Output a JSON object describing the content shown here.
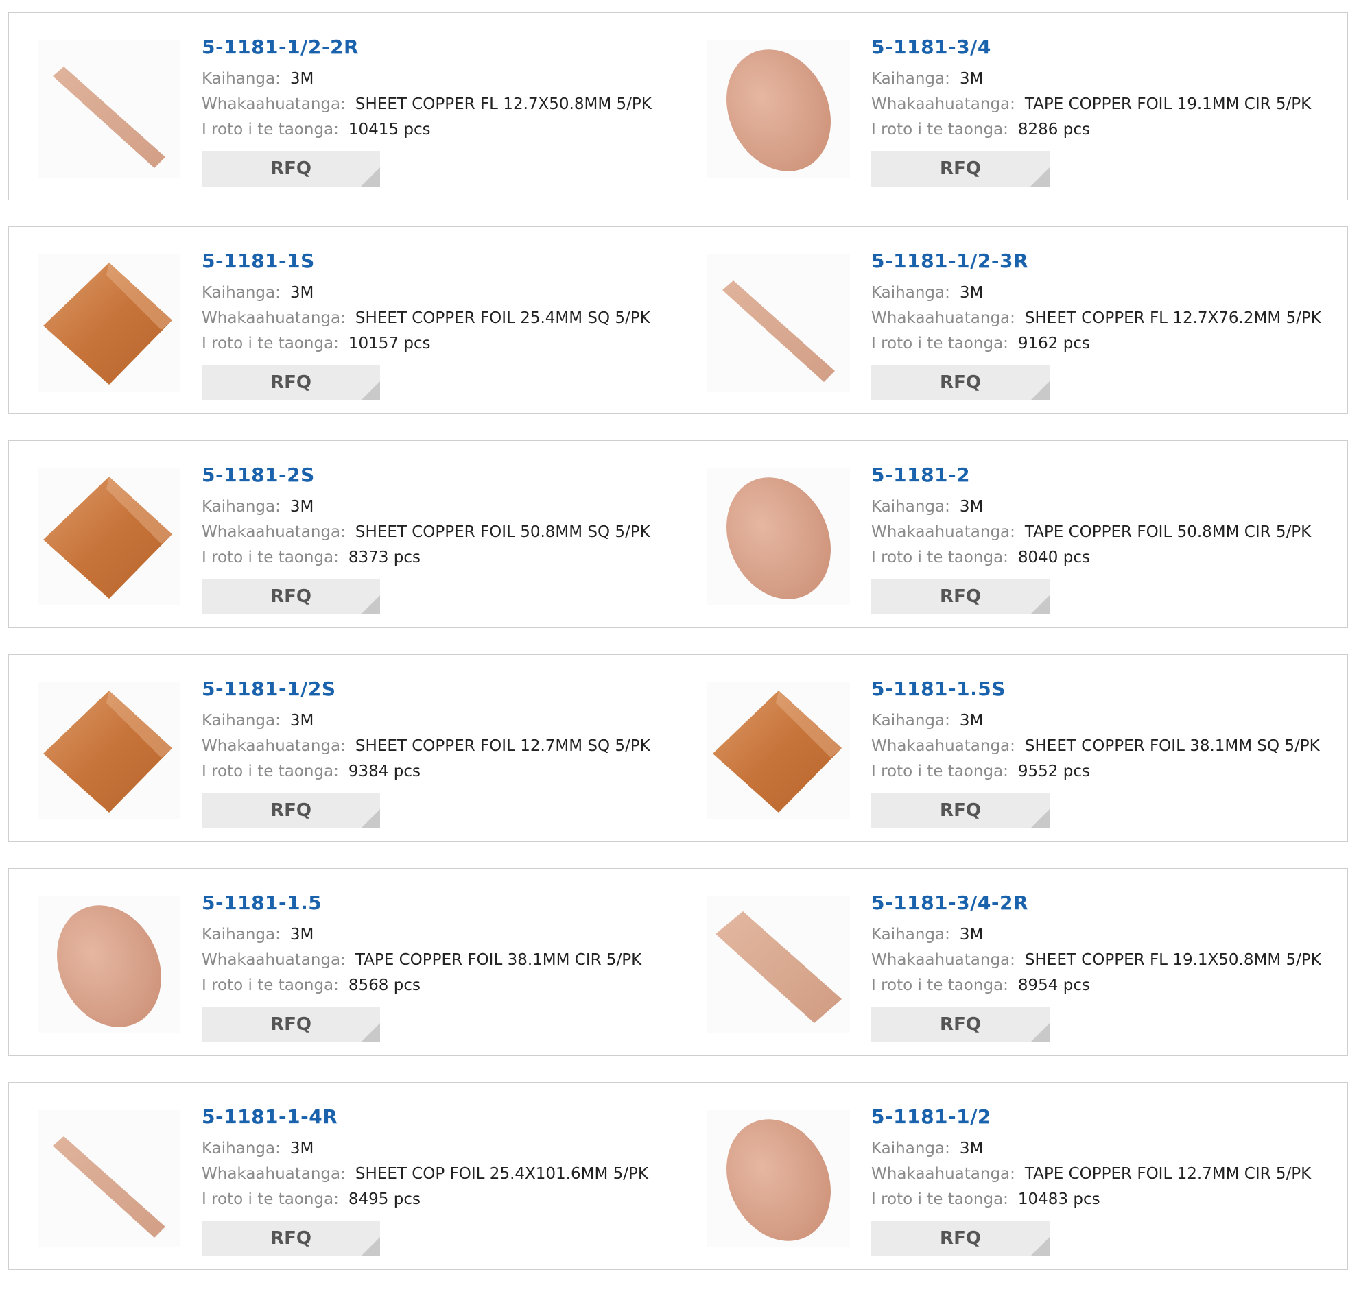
{
  "labels": {
    "manufacturer": "Kaihanga:",
    "description": "Whakaahuatanga:",
    "stock": "I roto i te taonga:",
    "rfq": "RFQ"
  },
  "colors": {
    "part_number": "#1a62ac",
    "copper_sheet": "#c9773e",
    "copper_tape": "#d9a08a"
  },
  "products": [
    {
      "part": "5-1181-1/2-2R",
      "manufacturer": "3M",
      "description": "SHEET COPPER FL 12.7X50.8MM 5/PK",
      "stock": "10415 pcs",
      "image": "strip-icon"
    },
    {
      "part": "5-1181-3/4",
      "manufacturer": "3M",
      "description": "TAPE COPPER FOIL 19.1MM CIR 5/PK",
      "stock": "8286 pcs",
      "image": "disc-icon"
    },
    {
      "part": "5-1181-1S",
      "manufacturer": "3M",
      "description": "SHEET COPPER FOIL 25.4MM SQ 5/PK",
      "stock": "10157 pcs",
      "image": "square-sheet-icon"
    },
    {
      "part": "5-1181-1/2-3R",
      "manufacturer": "3M",
      "description": "SHEET COPPER FL 12.7X76.2MM 5/PK",
      "stock": "9162 pcs",
      "image": "strip-icon"
    },
    {
      "part": "5-1181-2S",
      "manufacturer": "3M",
      "description": "SHEET COPPER FOIL 50.8MM SQ 5/PK",
      "stock": "8373 pcs",
      "image": "square-sheet-icon"
    },
    {
      "part": "5-1181-2",
      "manufacturer": "3M",
      "description": "TAPE COPPER FOIL 50.8MM CIR 5/PK",
      "stock": "8040 pcs",
      "image": "disc-icon"
    },
    {
      "part": "5-1181-1/2S",
      "manufacturer": "3M",
      "description": "SHEET COPPER FOIL 12.7MM SQ 5/PK",
      "stock": "9384 pcs",
      "image": "square-sheet-icon"
    },
    {
      "part": "5-1181-1.5S",
      "manufacturer": "3M",
      "description": "SHEET COPPER FOIL 38.1MM SQ 5/PK",
      "stock": "9552 pcs",
      "image": "square-sheet-icon"
    },
    {
      "part": "5-1181-1.5",
      "manufacturer": "3M",
      "description": "TAPE COPPER FOIL 38.1MM CIR 5/PK",
      "stock": "8568 pcs",
      "image": "disc-icon"
    },
    {
      "part": "5-1181-3/4-2R",
      "manufacturer": "3M",
      "description": "SHEET COPPER FL 19.1X50.8MM 5/PK",
      "stock": "8954 pcs",
      "image": "wide-strip-icon"
    },
    {
      "part": "5-1181-1-4R",
      "manufacturer": "3M",
      "description": "SHEET COP FOIL 25.4X101.6MM 5/PK",
      "stock": "8495 pcs",
      "image": "strip-icon"
    },
    {
      "part": "5-1181-1/2",
      "manufacturer": "3M",
      "description": "TAPE COPPER FOIL 12.7MM CIR 5/PK",
      "stock": "10483 pcs",
      "image": "disc-icon"
    }
  ]
}
